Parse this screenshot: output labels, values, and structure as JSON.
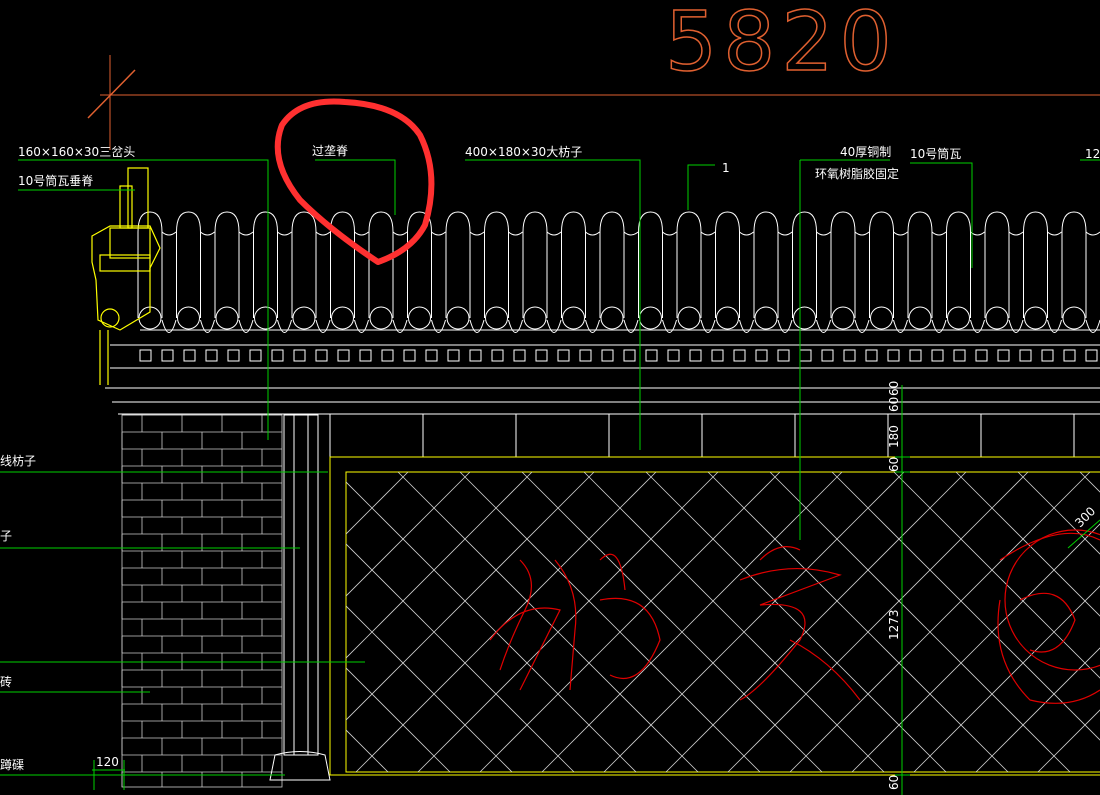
{
  "drawing": {
    "big_dimension": "5820",
    "annotations": {
      "sanchatou": "160×160×30三岔头",
      "tongwa_chuiji": "10号筒瓦垂脊",
      "guolongji": "过垄脊",
      "dafangzi": "400×180×30大枋子",
      "index_mark": "1",
      "copper_a": "40厚铜制",
      "copper_b": "环氧树脂胶固定",
      "tongwa": "10号筒瓦",
      "cut_12": "12",
      "left_1": "线枋子",
      "left_2": "子",
      "left_3": "砖",
      "left_4": "蹲磲"
    },
    "dimensions": {
      "d120": "120",
      "v60a": "60",
      "v180": "180",
      "v60b": "60",
      "v60c": "60",
      "v1273": "1273",
      "v60d": "60",
      "d300": "300"
    },
    "signboard_text": "北京园",
    "markup": "red freehand circle around 过垄脊 callout"
  },
  "colors": {
    "background": "#000000",
    "tile": "#ffffff",
    "leader": "#00d000",
    "dimension": "#e06030",
    "accent": "#ffff00",
    "calligraphy": "#e00000",
    "markup": "#ff3030"
  }
}
